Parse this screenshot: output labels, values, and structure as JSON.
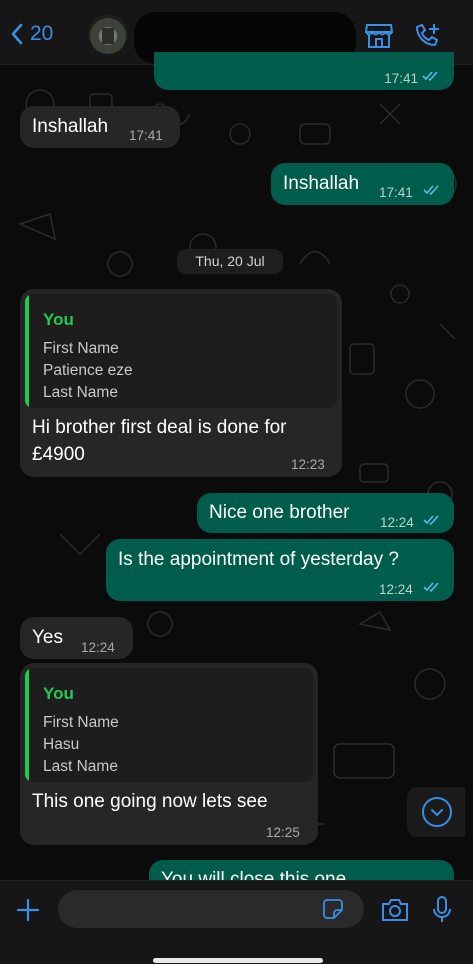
{
  "header": {
    "back_count": "20"
  },
  "date_separator": "Thu, 20 Jul",
  "messages": [
    {
      "text": "",
      "time": "17:41"
    },
    {
      "text": "Inshallah",
      "time": "17:41"
    },
    {
      "text": "Inshallah",
      "time": "17:41"
    },
    {
      "quote_author": "You",
      "quote_lines": [
        "First Name",
        "Patience eze",
        "Last Name"
      ],
      "text_line1": "Hi brother first deal is done for",
      "text_line2": "£4900",
      "time": "12:23"
    },
    {
      "text": "Nice one brother",
      "time": "12:24"
    },
    {
      "text": "Is the appointment of yesterday ?",
      "time": "12:24"
    },
    {
      "text": "Yes",
      "time": "12:24"
    },
    {
      "quote_author": "You",
      "quote_lines": [
        "First Name",
        "Hasu",
        "Last Name"
      ],
      "text": "This one going now lets see",
      "time": "12:25"
    },
    {
      "text": "You will close this one"
    }
  ],
  "composer": {
    "value": "",
    "placeholder": ""
  },
  "colors": {
    "accent": "#3a8ee6",
    "outgoing_bubble": "#005c4b",
    "incoming_bubble": "#262626",
    "quote_author": "#1fcc4e",
    "read_ticks": "#53bdeb"
  }
}
